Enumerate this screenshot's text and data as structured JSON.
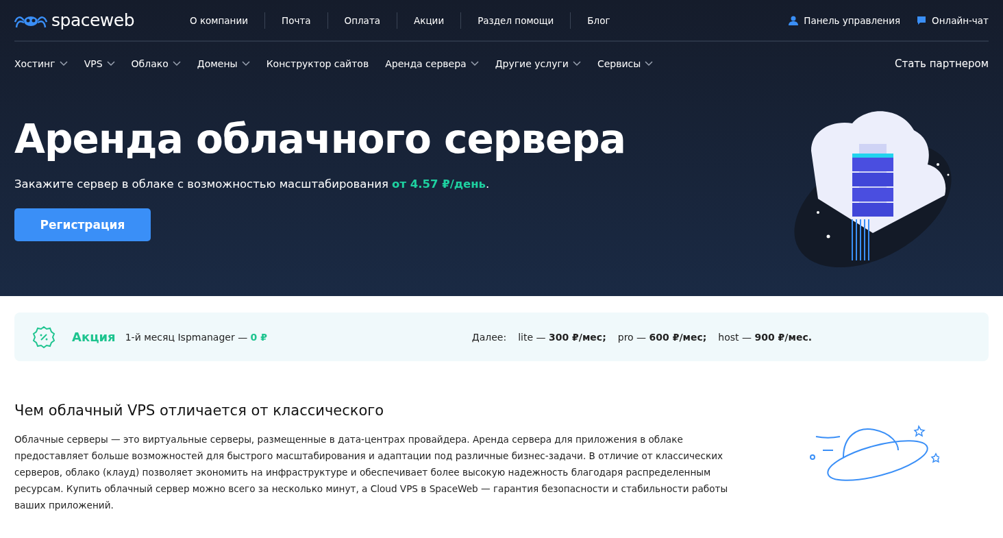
{
  "logo": {
    "text": "spaceweb"
  },
  "top_links": [
    "О компании",
    "Почта",
    "Оплата",
    "Акции",
    "Раздел помощи",
    "Блог"
  ],
  "account_links": [
    {
      "kind": "user",
      "label": "Панель управления"
    },
    {
      "kind": "chat",
      "label": "Онлайн-чат"
    }
  ],
  "nav": [
    {
      "label": "Хостинг",
      "dropdown": true
    },
    {
      "label": "VPS",
      "dropdown": true
    },
    {
      "label": "Облако",
      "dropdown": true
    },
    {
      "label": "Домены",
      "dropdown": true
    },
    {
      "label": "Конструктор сайтов",
      "dropdown": false
    },
    {
      "label": "Аренда сервера",
      "dropdown": true
    },
    {
      "label": "Другие услуги",
      "dropdown": true
    },
    {
      "label": "Сервисы",
      "dropdown": true
    }
  ],
  "partner_link": "Стать партнером",
  "hero": {
    "title": "Аренда облачного сервера",
    "subtitle": "Закажите сервер в облаке с возможностью масштабирования ",
    "price": "от 4.57 ₽/день",
    "end": ".",
    "button": "Регистрация"
  },
  "promo": {
    "label": "Акция",
    "text": "1-й месяц Ispmanager — ",
    "price": "0 ₽",
    "next_label": "Далее:",
    "plans": [
      "lite — **300 ₽/мес;**",
      "pro — **600 ₽/мес;**",
      "host — **900 ₽/мес.**"
    ]
  },
  "section": {
    "heading": "Чем облачный VPS отличается от классического",
    "paragraph": "Облачные серверы — это виртуальные серверы, размещенные в дата-центрах провайдера. Аренда сервера для приложения в облаке предоставляет больше возможностей для быстрого масштабирования и адаптации под различные бизнес-задачи. В отличие от классических серверов, облако (клауд) позволяет экономить на инфраструктуре и обеспечивает более высокую надежность благодаря распределенным ресурсам. Купить облачный сервер можно всего за несколько минут, а Cloud VPS в SpaceWeb — гарантия безопасности и стабильности работы ваших приложений."
  }
}
